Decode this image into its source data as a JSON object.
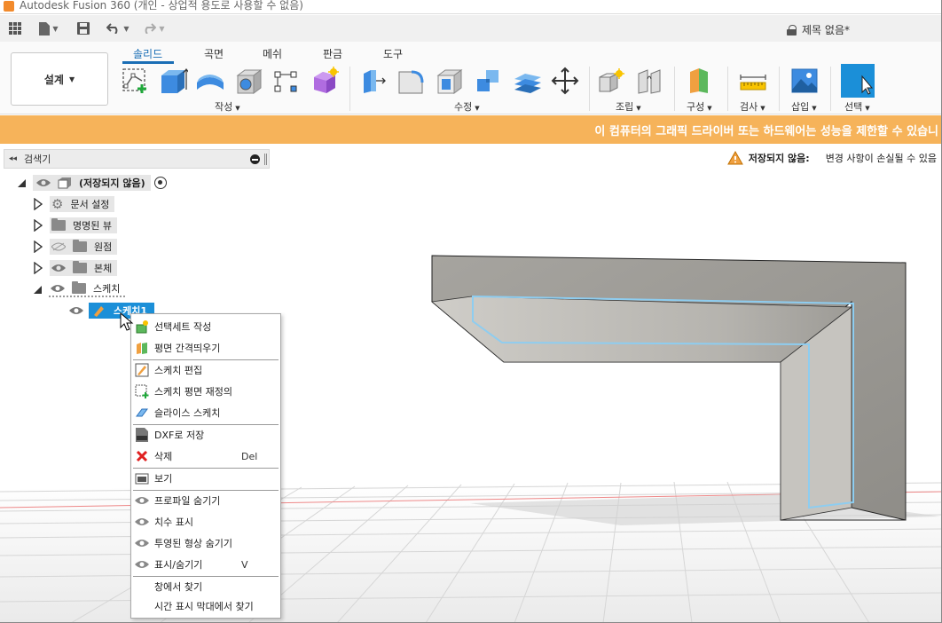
{
  "window": {
    "title": "Autodesk Fusion 360 (개인 - 상업적 용도로 사용할 수 없음)"
  },
  "quickbar": {
    "document_title": "제목 없음*",
    "icons": [
      "grid-icon",
      "file-icon",
      "save-icon",
      "undo-icon",
      "redo-icon",
      "lock-icon"
    ]
  },
  "ribbon": {
    "workspace_label": "설계",
    "tabs": [
      {
        "label": "솔리드",
        "active": true
      },
      {
        "label": "곡면",
        "active": false
      },
      {
        "label": "메쉬",
        "active": false
      },
      {
        "label": "판금",
        "active": false
      },
      {
        "label": "도구",
        "active": false
      }
    ],
    "groups": {
      "create": "작성",
      "modify": "수정",
      "assemble": "조립",
      "construct": "구성",
      "inspect": "검사",
      "insert": "삽입",
      "select": "선택"
    }
  },
  "banner": {
    "text": "이 컴퓨터의 그래픽 드라이버 또는 하드웨어는 성능을 제한할 수 있습니"
  },
  "browser": {
    "title": "검색기",
    "root": "(저장되지 않음)",
    "items": [
      {
        "label": "문서 설정",
        "icon": "gear-icon"
      },
      {
        "label": "명명된 뷰",
        "icon": "folder-icon"
      },
      {
        "label": "원점",
        "icon": "folder-icon"
      },
      {
        "label": "본체",
        "icon": "folder-icon"
      },
      {
        "label": "스케치",
        "icon": "folder-icon"
      }
    ],
    "selected_sketch": "스케치1"
  },
  "unsaved": {
    "label": "저장되지 않음:",
    "message": "변경 사항이 손실될 수 있음"
  },
  "context_menu": {
    "items": [
      {
        "label": "선택세트 작성",
        "icon": "selection-set-icon",
        "shortcut": ""
      },
      {
        "label": "평면 간격띄우기",
        "icon": "offset-plane-icon",
        "shortcut": ""
      },
      {
        "label": "스케치 편집",
        "icon": "edit-sketch-icon",
        "shortcut": ""
      },
      {
        "label": "스케치 평면 재정의",
        "icon": "redefine-plane-icon",
        "shortcut": ""
      },
      {
        "label": "슬라이스 스케치",
        "icon": "slice-icon",
        "shortcut": ""
      },
      {
        "label": "DXF로 저장",
        "icon": "dxf-icon",
        "shortcut": ""
      },
      {
        "label": "삭제",
        "icon": "delete-icon",
        "shortcut": "Del"
      },
      {
        "label": "보기",
        "icon": "look-at-icon",
        "shortcut": ""
      },
      {
        "label": "프로파일 숨기기",
        "icon": "eye-icon",
        "shortcut": ""
      },
      {
        "label": "치수 표시",
        "icon": "eye-icon",
        "shortcut": ""
      },
      {
        "label": "투영된 형상 숨기기",
        "icon": "eye-icon",
        "shortcut": ""
      },
      {
        "label": "표시/숨기기",
        "icon": "eye-icon",
        "shortcut": "V"
      },
      {
        "label": "창에서 찾기",
        "icon": "",
        "shortcut": ""
      },
      {
        "label": "시간 표시 막대에서 찾기",
        "icon": "",
        "shortcut": ""
      }
    ]
  },
  "colors": {
    "accent": "#1a6eb5",
    "banner": "#f6b35a",
    "selection": "#1b8fd8"
  }
}
